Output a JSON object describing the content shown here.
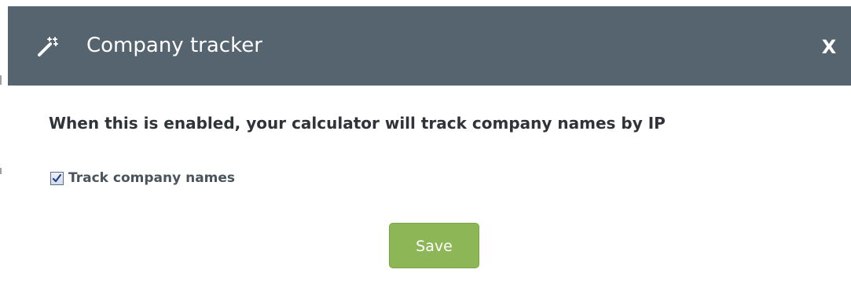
{
  "dialog": {
    "title": "Company tracker",
    "close_label": "X",
    "description": "When this is enabled, your calculator will track company names by IP",
    "checkbox": {
      "label": "Track company names",
      "checked": true
    },
    "save_label": "Save"
  },
  "colors": {
    "header_bg": "#56646f",
    "save_bg": "#8db656"
  },
  "icons": {
    "header_icon": "magic-wand-icon",
    "checkbox_icon": "checkmark-icon"
  }
}
